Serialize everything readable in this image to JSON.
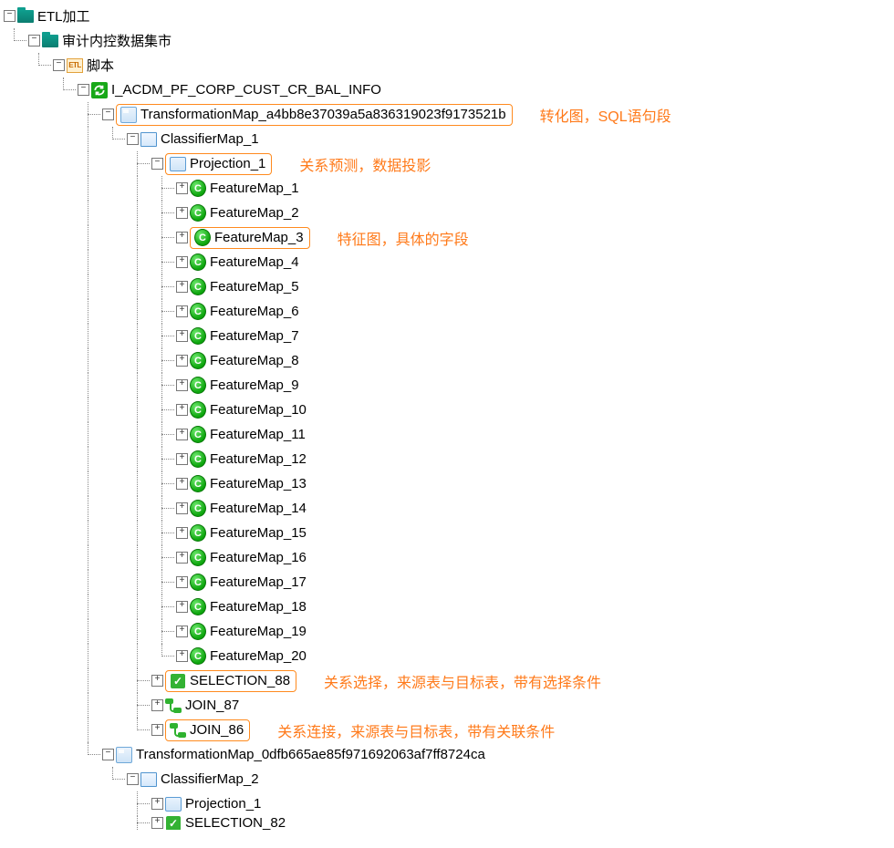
{
  "tree": {
    "root": "ETL加工",
    "mart": "审计内控数据集市",
    "scripts": "脚本",
    "job": "I_ACDM_PF_CORP_CUST_CR_BAL_INFO",
    "tmap1": "TransformationMap_a4bb8e37039a5a836319023f9173521b",
    "cmap1": "ClassifierMap_1",
    "proj1": "Projection_1",
    "features": [
      "FeatureMap_1",
      "FeatureMap_2",
      "FeatureMap_3",
      "FeatureMap_4",
      "FeatureMap_5",
      "FeatureMap_6",
      "FeatureMap_7",
      "FeatureMap_8",
      "FeatureMap_9",
      "FeatureMap_10",
      "FeatureMap_11",
      "FeatureMap_12",
      "FeatureMap_13",
      "FeatureMap_14",
      "FeatureMap_15",
      "FeatureMap_16",
      "FeatureMap_17",
      "FeatureMap_18",
      "FeatureMap_19",
      "FeatureMap_20"
    ],
    "sel88": "SELECTION_88",
    "join87": "JOIN_87",
    "join86": "JOIN_86",
    "tmap2": "TransformationMap_0dfb665ae85f971692063af7ff8724ca",
    "cmap2": "ClassifierMap_2",
    "proj2": "Projection_1",
    "sel82": "SELECTION_82"
  },
  "annot": {
    "tmap": "转化图，SQL语句段",
    "proj": "关系预测，数据投影",
    "feat": "特征图，具体的字段",
    "sel": "关系选择，来源表与目标表，带有选择条件",
    "join": "关系连接，来源表与目标表，带有关联条件"
  },
  "glyph": {
    "c": "C",
    "chk": "✓",
    "etl": "ETL"
  }
}
